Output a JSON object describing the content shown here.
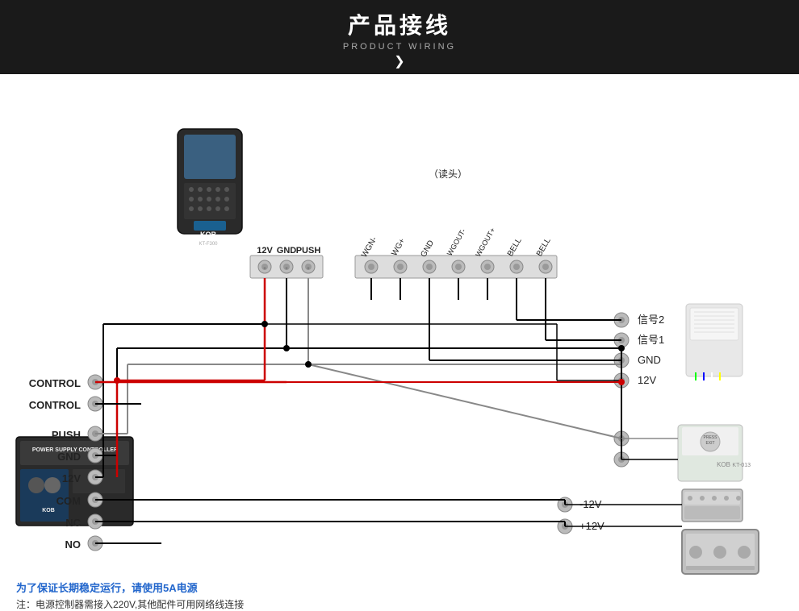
{
  "header": {
    "title_cn": "产品接线",
    "title_en": "PRODUCT WIRING",
    "chevron": "❯"
  },
  "footer": {
    "line1": "为了保证长期稳定运行，请使用5A电源",
    "line2": "注：电源控制器需接入220V,其他配件可用网络线连接"
  },
  "labels": {
    "reader_header": "（读头）",
    "terminals_top": [
      "12V",
      "GND",
      "PUSH",
      "WGN-",
      "WG+",
      "GND",
      "WGOUT-",
      "WGOUT+",
      "BELL",
      "BELL"
    ],
    "left_labels": [
      "CONTROL",
      "CONTROL",
      "PUSH",
      "GND",
      "12V",
      "COM",
      "NC",
      "NO"
    ],
    "right_labels_top": [
      "信号2",
      "信号1",
      "GND",
      "12V"
    ],
    "right_labels_mid": [
      "-12V",
      "+12V"
    ],
    "brand": "KOB"
  }
}
